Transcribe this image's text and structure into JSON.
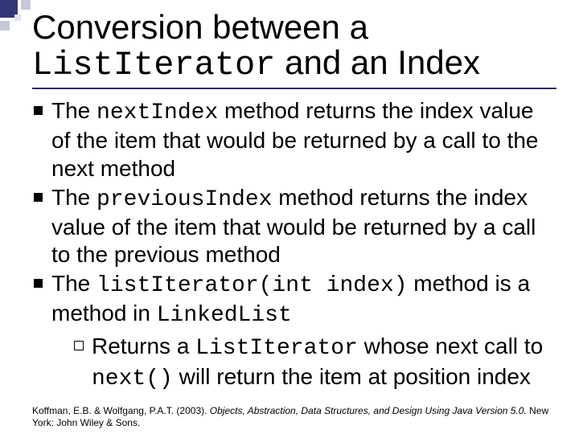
{
  "title": {
    "line1": "Conversion between a",
    "code": "ListIterator",
    "line2_tail": " and an Index"
  },
  "bullets": [
    {
      "segments": [
        {
          "t": "The "
        },
        {
          "t": "nextIndex",
          "mono": true
        },
        {
          "t": " method returns the index value of the item that would be returned by a call to the next method"
        }
      ]
    },
    {
      "segments": [
        {
          "t": "The "
        },
        {
          "t": "previousIndex",
          "mono": true
        },
        {
          "t": " method returns the index value of the item that would be returned by a call to the previous method"
        }
      ]
    },
    {
      "segments": [
        {
          "t": "The "
        },
        {
          "t": "listIterator(int index)",
          "mono": true
        },
        {
          "t": " method is a method in "
        },
        {
          "t": "LinkedList",
          "mono": true
        }
      ],
      "sub": [
        {
          "segments": [
            {
              "t": "Returns a "
            },
            {
              "t": "ListIterator",
              "mono": true
            },
            {
              "t": " whose next call to "
            },
            {
              "t": "next()",
              "mono": true
            },
            {
              "t": " will return the item at position index"
            }
          ]
        }
      ]
    }
  ],
  "footer": {
    "prefix": "Koffman, E.B. & Wolfgang, P.A.T. (2003). ",
    "ital": "Objects, Abstraction, Data Structures, and Design Using Java Version 5.0. ",
    "suffix": "New York: John Wiley & Sons."
  }
}
